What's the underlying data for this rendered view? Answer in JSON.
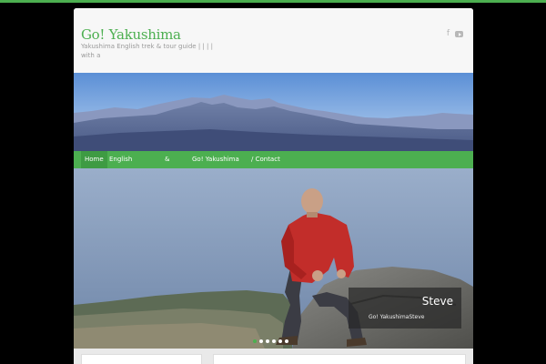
{
  "site": {
    "title": "Go! Yakushima",
    "description": "Yakushima English trek & tour guide |  |  |  | with a"
  },
  "social": {
    "icons": [
      "facebook-icon",
      "youtube-icon"
    ]
  },
  "nav": {
    "items": [
      "Home",
      "English",
      "&",
      "Go! Yakushima",
      "/ Contact"
    ],
    "active": "Home"
  },
  "slider": {
    "caption_title": "Steve",
    "caption_subtitle": "Go! YakushimaSteve",
    "slide_count": 5
  },
  "colors": {
    "accent": "#4caf50",
    "header_bg": "#f7f7f7",
    "page_bg": "#000000"
  }
}
